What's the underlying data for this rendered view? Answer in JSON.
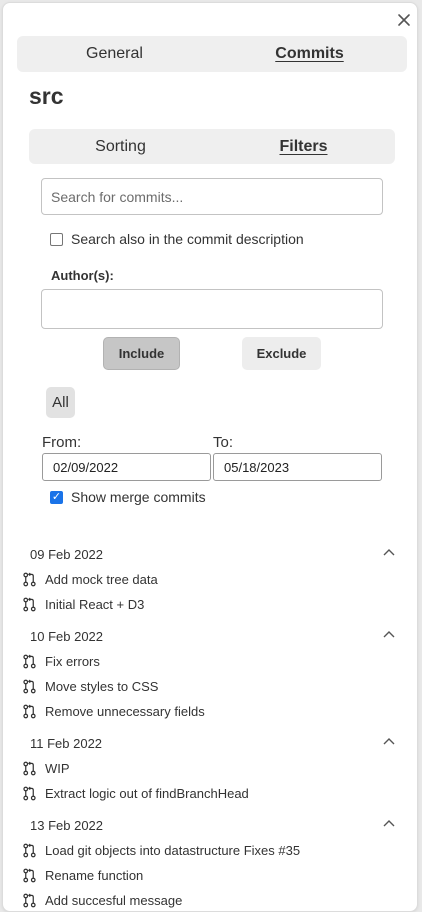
{
  "close_icon": "close-icon",
  "top_tabs": [
    {
      "label": "General",
      "active": false
    },
    {
      "label": "Commits",
      "active": true
    }
  ],
  "title": "src",
  "sub_tabs": [
    {
      "label": "Sorting",
      "active": false
    },
    {
      "label": "Filters",
      "active": true
    }
  ],
  "filters": {
    "search_placeholder": "Search for commits...",
    "search_value": "",
    "search_description_label": "Search also in the commit description",
    "search_description_checked": false,
    "authors_label": "Author(s):",
    "authors_value": "",
    "include_label": "Include",
    "exclude_label": "Exclude",
    "all_label": "All",
    "from_label": "From:",
    "to_label": "To:",
    "from_value": "02/09/2022",
    "to_value": "05/18/2023",
    "show_merge_label": "Show merge commits",
    "show_merge_checked": true
  },
  "groups": [
    {
      "date": "09 Feb 2022",
      "commits": [
        "Add mock tree data",
        "Initial React + D3"
      ]
    },
    {
      "date": "10 Feb 2022",
      "commits": [
        "Fix errors",
        "Move styles to CSS",
        "Remove unnecessary fields"
      ]
    },
    {
      "date": "11 Feb 2022",
      "commits": [
        "WIP",
        "Extract logic out of findBranchHead"
      ]
    },
    {
      "date": "13 Feb 2022",
      "commits": [
        "Load git objects into datastructure Fixes #35",
        "Rename function",
        "Add succesful message"
      ]
    }
  ]
}
